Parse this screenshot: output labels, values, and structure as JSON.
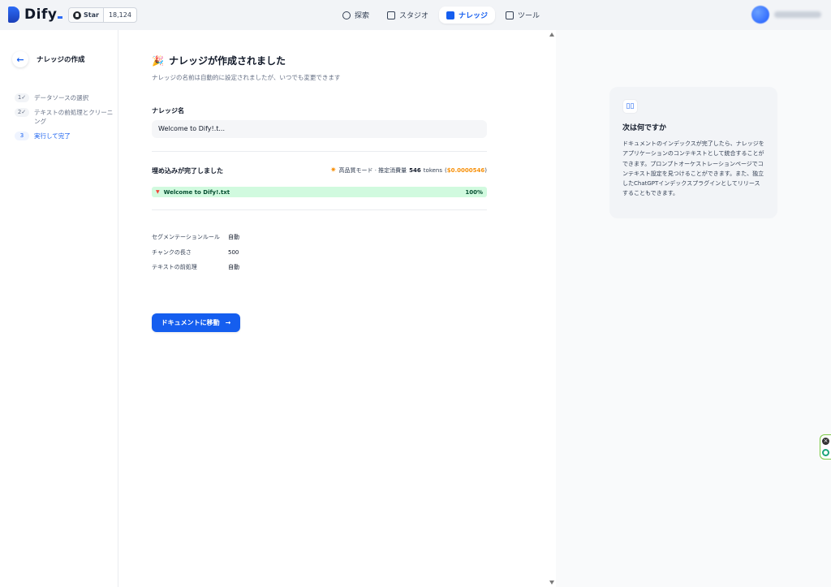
{
  "header": {
    "logo_text": "Dify",
    "github": {
      "star_label": "Star",
      "star_count": "18,124"
    },
    "nav": [
      {
        "label": "探索",
        "icon": "compass-icon",
        "active": false
      },
      {
        "label": "スタジオ",
        "icon": "studio-icon",
        "active": false
      },
      {
        "label": "ナレッジ",
        "icon": "book-icon",
        "active": true
      },
      {
        "label": "ツール",
        "icon": "tool-icon",
        "active": false
      }
    ]
  },
  "sidebar": {
    "title": "ナレッジの作成",
    "steps": [
      {
        "num": "1",
        "label": "データソースの選択",
        "done": true
      },
      {
        "num": "2",
        "label": "テキストの前処理とクリーニング",
        "done": true
      },
      {
        "num": "3",
        "label": "実行して完了",
        "active": true
      }
    ]
  },
  "main": {
    "title": "ナレッジが作成されました",
    "subtitle": "ナレッジの名前は自動的に設定されましたが、いつでも変更できます",
    "name_label": "ナレッジ名",
    "name_value": "Welcome to Dify!.t...",
    "embed_title": "埋め込みが完了しました",
    "mode_text": "高品質モード · 推定消費量",
    "tokens": "546",
    "tokens_unit": "tokens",
    "cost_open": "(",
    "cost": "$0.0000546",
    "cost_close": ")",
    "file_name": "Welcome to Dify!.txt",
    "progress_label": "100%",
    "progress": 1.0,
    "info": [
      {
        "key": "セグメンテーションルール",
        "value": "自動"
      },
      {
        "key": "チャンクの長さ",
        "value": "500"
      },
      {
        "key": "テキストの前処理",
        "value": "自動"
      }
    ],
    "button_label": "ドキュメントに移動"
  },
  "right_panel": {
    "title": "次は何ですか",
    "body": "ドキュメントのインデックスが完了したら、ナレッジをアプリケーションのコンテキストとして統合することができます。プロンプトオーケストレーションページでコンテキスト設定を見つけることができます。また、独立したChatGPTインデックスプラグインとしてリリースすることもできます。"
  },
  "colors": {
    "accent": "#155eef",
    "progress_bg": "#d1fadf",
    "cost": "#f79009"
  }
}
